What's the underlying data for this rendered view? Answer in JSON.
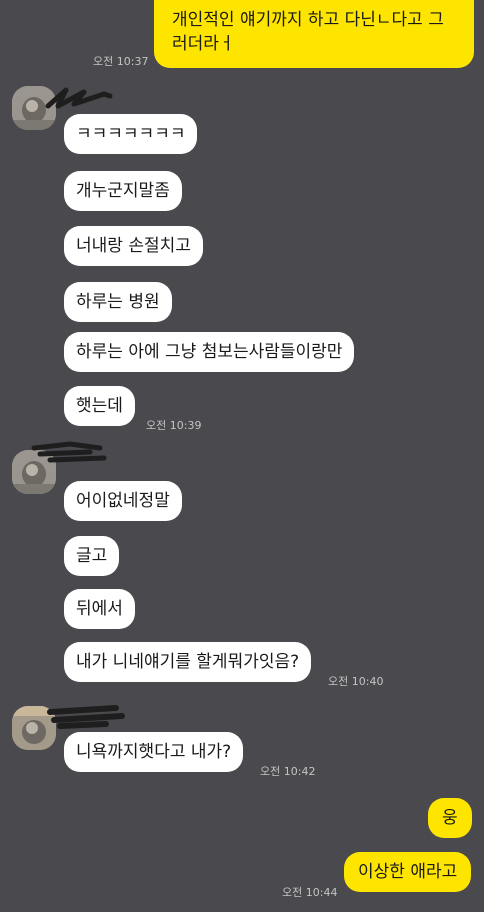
{
  "chat": {
    "messages": [
      {
        "text": "개인적인 얘기까지 하고 다닌ㄴ다고 그러더라ㅓ",
        "time": "오전 10:37"
      },
      {
        "text": "ㅋㅋㅋㅋㅋㅋㅋ"
      },
      {
        "text": "개누군지말좀"
      },
      {
        "text": "너내랑 손절치고"
      },
      {
        "text": "하루는 병원"
      },
      {
        "text": "하루는 아에 그냥 첨보는사람들이랑만"
      },
      {
        "text": "햇는데",
        "time": "오전 10:39"
      },
      {
        "text": "어이없네정말"
      },
      {
        "text": "글고"
      },
      {
        "text": "뒤에서"
      },
      {
        "text": "내가 니네얘기를 할게뭐가잇음?",
        "time": "오전 10:40"
      },
      {
        "text": "니욕까지햇다고 내가?",
        "time": "오전 10:42"
      },
      {
        "text": "웅"
      },
      {
        "text": "이상한 애라고",
        "time": "오전 10:44"
      }
    ]
  },
  "icons": {
    "avatar": "profile-photo",
    "redaction": "scribble-redaction"
  },
  "colors": {
    "background": "#4a494d",
    "outgoing_bubble": "#fee500",
    "incoming_bubble": "#ffffff",
    "timestamp": "#c4c4c4"
  }
}
